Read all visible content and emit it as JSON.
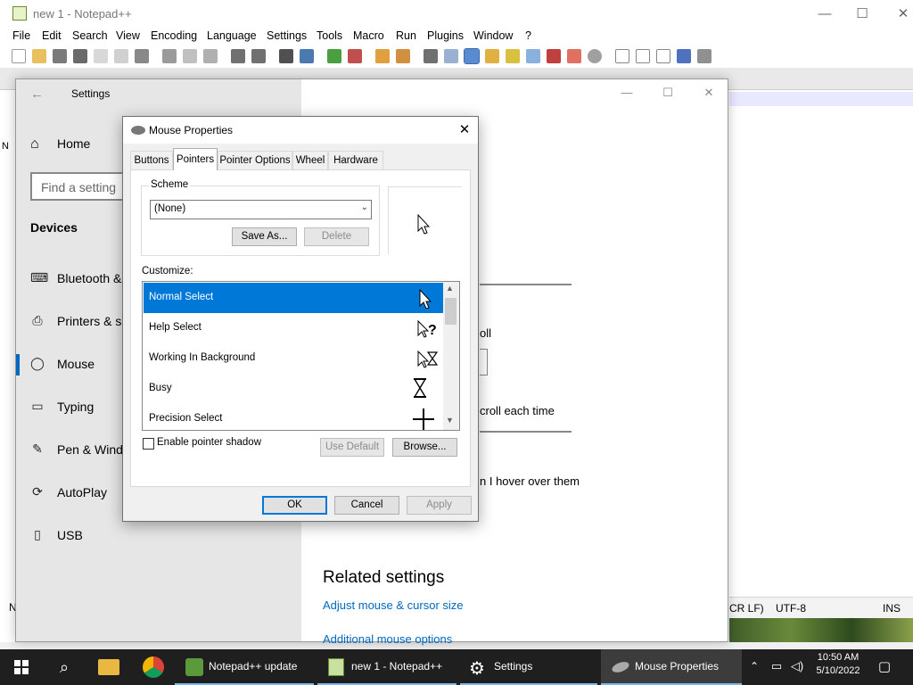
{
  "notepad": {
    "title": "new 1 - Notepad++",
    "menu": [
      "File",
      "Edit",
      "Search",
      "View",
      "Encoding",
      "Language",
      "Settings",
      "Tools",
      "Macro",
      "Run",
      "Plugins",
      "Window",
      "?"
    ],
    "status": {
      "eol": "CR LF)",
      "encoding": "UTF-8",
      "mode": "INS"
    },
    "edge_text_1": "N",
    "edge_text_2": "N"
  },
  "settings": {
    "title": "Settings",
    "home": "Home",
    "search_placeholder": "Find a setting",
    "section": "Devices",
    "nav": [
      {
        "label": "Bluetooth & ",
        "icon": "bluetooth-icon"
      },
      {
        "label": "Printers & sc",
        "icon": "printer-icon"
      },
      {
        "label": "Mouse",
        "icon": "mouse-icon"
      },
      {
        "label": "Typing",
        "icon": "keyboard-icon"
      },
      {
        "label": "Pen & Wind",
        "icon": "pen-icon"
      },
      {
        "label": "AutoPlay",
        "icon": "autoplay-icon"
      },
      {
        "label": "USB",
        "icon": "usb-icon"
      }
    ],
    "fragments": {
      "scroll": "oll",
      "scroll_each_time": "croll each time",
      "hover": "n I hover over them"
    },
    "related_title": "Related settings",
    "related_links": [
      "Adjust mouse & cursor size",
      "Additional mouse options"
    ]
  },
  "dialog": {
    "title": "Mouse Properties",
    "tabs": [
      "Buttons",
      "Pointers",
      "Pointer Options",
      "Wheel",
      "Hardware"
    ],
    "active_tab": "Pointers",
    "scheme_label": "Scheme",
    "scheme_value": "(None)",
    "save_as": "Save As...",
    "delete": "Delete",
    "customize_label": "Customize:",
    "pointers": [
      {
        "label": "Normal Select",
        "cursor": "arrow",
        "selected": true
      },
      {
        "label": "Help Select",
        "cursor": "help",
        "selected": false
      },
      {
        "label": "Working In Background",
        "cursor": "working",
        "selected": false
      },
      {
        "label": "Busy",
        "cursor": "busy",
        "selected": false
      },
      {
        "label": "Precision Select",
        "cursor": "crosshair",
        "selected": false
      }
    ],
    "enable_shadow": "Enable pointer shadow",
    "use_default": "Use Default",
    "browse": "Browse...",
    "ok": "OK",
    "cancel": "Cancel",
    "apply": "Apply"
  },
  "taskbar": {
    "tasks": [
      "Notepad++ update",
      "new 1 - Notepad++",
      "Settings",
      "Mouse Properties"
    ],
    "time": "10:50 AM",
    "date": "5/10/2022"
  }
}
